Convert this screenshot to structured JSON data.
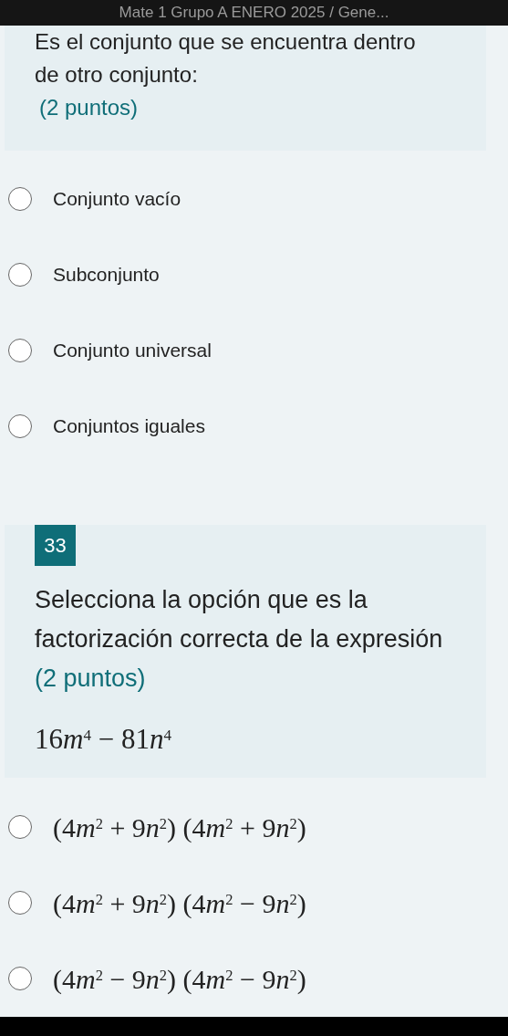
{
  "header": {
    "title": "Mate 1 Grupo A ENERO 2025 / Gene..."
  },
  "questions": [
    {
      "kind": "plain",
      "text": "Es el conjunto que se encuentra dentro de otro conjunto:",
      "points": "(2 puntos)",
      "options": [
        {
          "kind": "text",
          "label": "Conjunto vacío",
          "selected": false
        },
        {
          "kind": "text",
          "label": "Subconjunto",
          "selected": false
        },
        {
          "kind": "text",
          "label": "Conjunto universal",
          "selected": false
        },
        {
          "kind": "text",
          "label": "Conjuntos iguales",
          "selected": false
        }
      ]
    },
    {
      "kind": "numbered",
      "number": "33",
      "text": "Selecciona la opción que es la factorización correcta de la expresión",
      "points": "(2 puntos)",
      "expression": [
        {
          "kind": "num",
          "text": "16"
        },
        {
          "kind": "var",
          "text": "m",
          "sup": "4"
        },
        {
          "kind": "op",
          "text": "−"
        },
        {
          "kind": "num",
          "text": "81"
        },
        {
          "kind": "var",
          "text": "n",
          "sup": "4"
        }
      ],
      "options": [
        {
          "kind": "math",
          "selected": false,
          "label": [
            {
              "kind": "num",
              "text": "(4"
            },
            {
              "kind": "var",
              "text": "m",
              "sup": "2"
            },
            {
              "kind": "op",
              "text": "+"
            },
            {
              "kind": "num",
              "text": "9"
            },
            {
              "kind": "var",
              "text": "n",
              "sup": "2"
            },
            {
              "kind": "num",
              "text": ") (4"
            },
            {
              "kind": "var",
              "text": "m",
              "sup": "2"
            },
            {
              "kind": "op",
              "text": "+"
            },
            {
              "kind": "num",
              "text": "9"
            },
            {
              "kind": "var",
              "text": "n",
              "sup": "2"
            },
            {
              "kind": "num",
              "text": ")"
            }
          ]
        },
        {
          "kind": "math",
          "selected": false,
          "label": [
            {
              "kind": "num",
              "text": "(4"
            },
            {
              "kind": "var",
              "text": "m",
              "sup": "2"
            },
            {
              "kind": "op",
              "text": "+"
            },
            {
              "kind": "num",
              "text": "9"
            },
            {
              "kind": "var",
              "text": "n",
              "sup": "2"
            },
            {
              "kind": "num",
              "text": ") (4"
            },
            {
              "kind": "var",
              "text": "m",
              "sup": "2"
            },
            {
              "kind": "op",
              "text": "−"
            },
            {
              "kind": "num",
              "text": "9"
            },
            {
              "kind": "var",
              "text": "n",
              "sup": "2"
            },
            {
              "kind": "num",
              "text": ")"
            }
          ]
        },
        {
          "kind": "math",
          "selected": false,
          "label": [
            {
              "kind": "num",
              "text": "(4"
            },
            {
              "kind": "var",
              "text": "m",
              "sup": "2"
            },
            {
              "kind": "op",
              "text": "−"
            },
            {
              "kind": "num",
              "text": "9"
            },
            {
              "kind": "var",
              "text": "n",
              "sup": "2"
            },
            {
              "kind": "num",
              "text": ") (4"
            },
            {
              "kind": "var",
              "text": "m",
              "sup": "2"
            },
            {
              "kind": "op",
              "text": "−"
            },
            {
              "kind": "num",
              "text": "9"
            },
            {
              "kind": "var",
              "text": "n",
              "sup": "2"
            },
            {
              "kind": "num",
              "text": ")"
            }
          ]
        }
      ]
    }
  ]
}
